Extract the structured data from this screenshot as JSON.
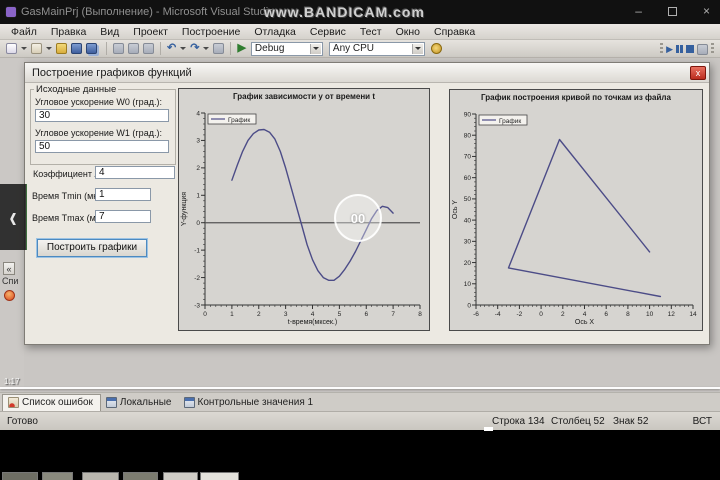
{
  "window": {
    "title": "GasMainPrj (Выполнение) - Microsoft Visual Studio",
    "minimize_glyph": "–",
    "close_glyph": "×"
  },
  "watermark": "www.BANDICAM.com",
  "menu": {
    "items": [
      "Файл",
      "Правка",
      "Вид",
      "Проект",
      "Построение",
      "Отладка",
      "Сервис",
      "Тест",
      "Окно",
      "Справка"
    ]
  },
  "toolbar": {
    "undo_glyph": "↶",
    "redo_glyph": "↷",
    "start_glyph": "▶",
    "debug_target": "Debug",
    "platform": "Any CPU",
    "continue_glyph": "▶"
  },
  "dialog": {
    "title": "Построение графиков функций",
    "close_glyph": "x",
    "group_title": "Исходные данные",
    "fields": [
      {
        "label": "Угловое ускорение W0 (град.):",
        "value": "30"
      },
      {
        "label": "Угловое ускорение W1 (град.):",
        "value": "50"
      },
      {
        "label": "Коэффициент А:",
        "value": "4"
      },
      {
        "label": "Время Tmin (мксек.):",
        "value": "1"
      },
      {
        "label": "Время Tmax (мксек.):",
        "value": "7"
      }
    ],
    "button": "Построить графики"
  },
  "chart_data": [
    {
      "type": "line",
      "title": "График зависимости y от времени t",
      "xlabel": "t-время(мксек.)",
      "ylabel": "Y-функция",
      "legend": [
        "График"
      ],
      "legend_position": "top-left",
      "xlim": [
        0,
        8
      ],
      "ylim": [
        -3,
        4
      ],
      "xticks": [
        0,
        1,
        2,
        3,
        4,
        5,
        6,
        7,
        8
      ],
      "yticks": [
        -3,
        -2,
        -1,
        0,
        1,
        2,
        3,
        4
      ],
      "grid": false,
      "zero_line": true,
      "line_color": "#4c4c87",
      "series": [
        {
          "name": "График",
          "points": [
            [
              1,
              1.55
            ],
            [
              1.2,
              2.1
            ],
            [
              1.4,
              2.6
            ],
            [
              1.6,
              3.0
            ],
            [
              1.8,
              3.25
            ],
            [
              2.0,
              3.38
            ],
            [
              2.2,
              3.4
            ],
            [
              2.4,
              3.3
            ],
            [
              2.6,
              3.05
            ],
            [
              2.8,
              2.6
            ],
            [
              3.0,
              2.0
            ],
            [
              3.2,
              1.3
            ],
            [
              3.4,
              0.6
            ],
            [
              3.6,
              -0.1
            ],
            [
              3.8,
              -0.8
            ],
            [
              4.0,
              -1.35
            ],
            [
              4.2,
              -1.75
            ],
            [
              4.4,
              -2.0
            ],
            [
              4.6,
              -2.1
            ],
            [
              4.8,
              -2.1
            ],
            [
              5.0,
              -1.95
            ],
            [
              5.2,
              -1.7
            ],
            [
              5.4,
              -1.4
            ],
            [
              5.6,
              -1.05
            ],
            [
              5.8,
              -0.65
            ],
            [
              6.0,
              -0.25
            ],
            [
              6.2,
              0.15
            ],
            [
              6.4,
              0.45
            ],
            [
              6.6,
              0.6
            ],
            [
              6.8,
              0.55
            ],
            [
              7.0,
              0.35
            ]
          ]
        }
      ]
    },
    {
      "type": "line",
      "title": "График построения кривой по точкам из файла",
      "xlabel": "Ось X",
      "ylabel": "Ось Y",
      "legend": [
        "График"
      ],
      "legend_position": "top-left",
      "xlim": [
        -6,
        14
      ],
      "ylim": [
        0,
        90
      ],
      "xticks": [
        -6,
        -4,
        -2,
        0,
        2,
        4,
        6,
        8,
        10,
        12,
        14
      ],
      "yticks": [
        0,
        10,
        20,
        30,
        40,
        50,
        60,
        70,
        80,
        90
      ],
      "grid": false,
      "zero_line": false,
      "line_color": "#4c4c87",
      "series": [
        {
          "name": "График",
          "points": [
            [
              10,
              25
            ],
            [
              1.7,
              78
            ],
            [
              -3,
              17.5
            ],
            [
              11,
              4
            ]
          ]
        }
      ]
    }
  ],
  "recording": {
    "time": "1:17",
    "click_badge": "00"
  },
  "left_panel": {
    "collapse_glyph": "«",
    "clipped_label": "Спи"
  },
  "side_nav": {
    "chevron": "‹"
  },
  "bottom_tabs": [
    {
      "label": "Список ошибок"
    },
    {
      "label": "Локальные"
    },
    {
      "label": "Контрольные значения 1"
    }
  ],
  "status": {
    "ready": "Готово",
    "line": "Строка 134",
    "column": "Столбец 52",
    "char": "Знак 52",
    "mode": "ВСТ"
  }
}
